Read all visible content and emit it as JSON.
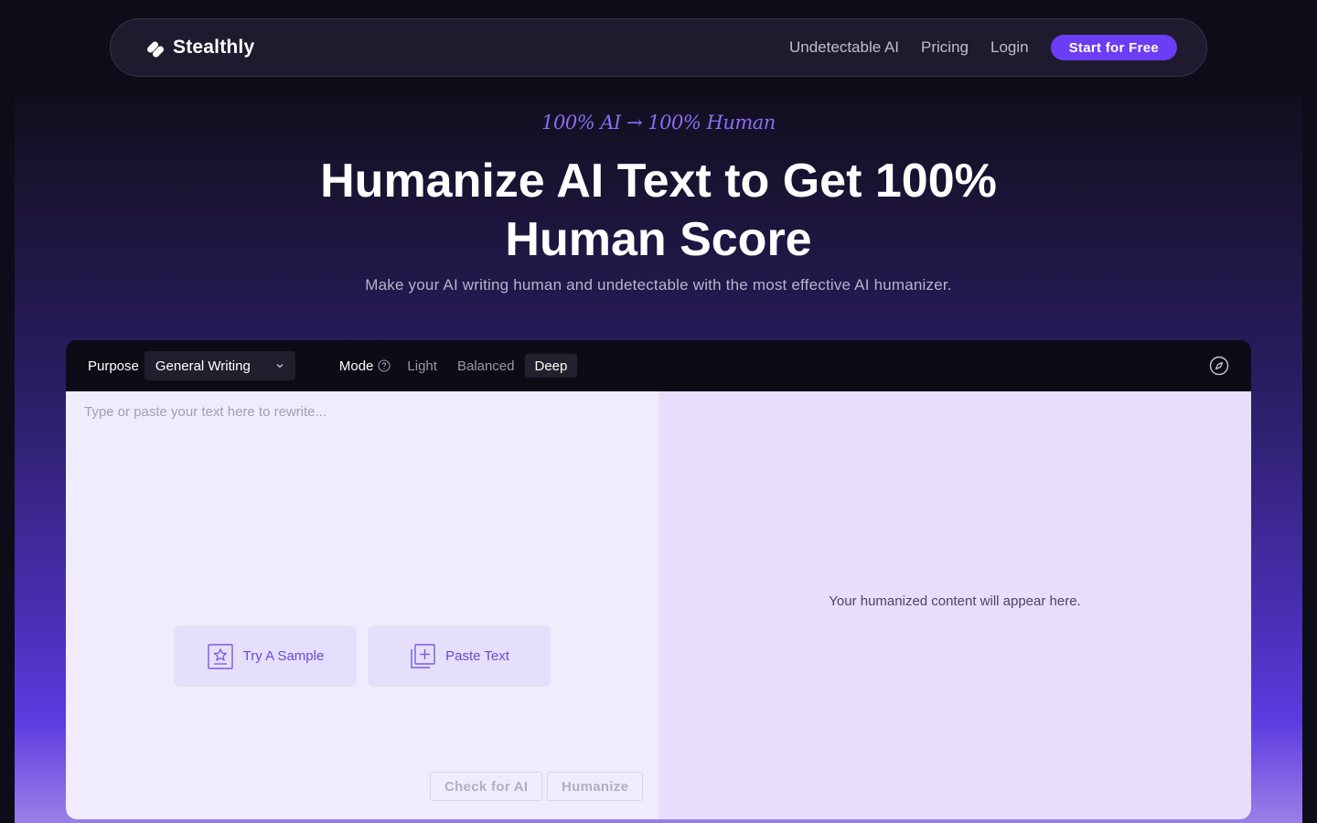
{
  "nav": {
    "brand": "Stealthly",
    "links": [
      "Undetectable AI",
      "Pricing",
      "Login"
    ],
    "cta": "Start for Free"
  },
  "hero": {
    "tagline": "100% AI → 100% Human",
    "title": "Humanize AI Text to Get 100% Human Score",
    "subtitle": "Make your AI writing human and undetectable with the most effective AI humanizer."
  },
  "tool": {
    "purpose_label": "Purpose",
    "purpose_value": "General Writing",
    "mode_label": "Mode",
    "modes": [
      "Light",
      "Balanced",
      "Deep"
    ],
    "active_mode": "Deep",
    "input_placeholder": "Type or paste your text here to rewrite...",
    "sample_button": "Try A Sample",
    "paste_button": "Paste Text",
    "check_button": "Check for AI",
    "humanize_button": "Humanize",
    "output_placeholder": "Your humanized content will appear here."
  },
  "colors": {
    "accent": "#6b3df5",
    "tagline": "#8b6cf5",
    "card_text": "#6a48d8"
  }
}
